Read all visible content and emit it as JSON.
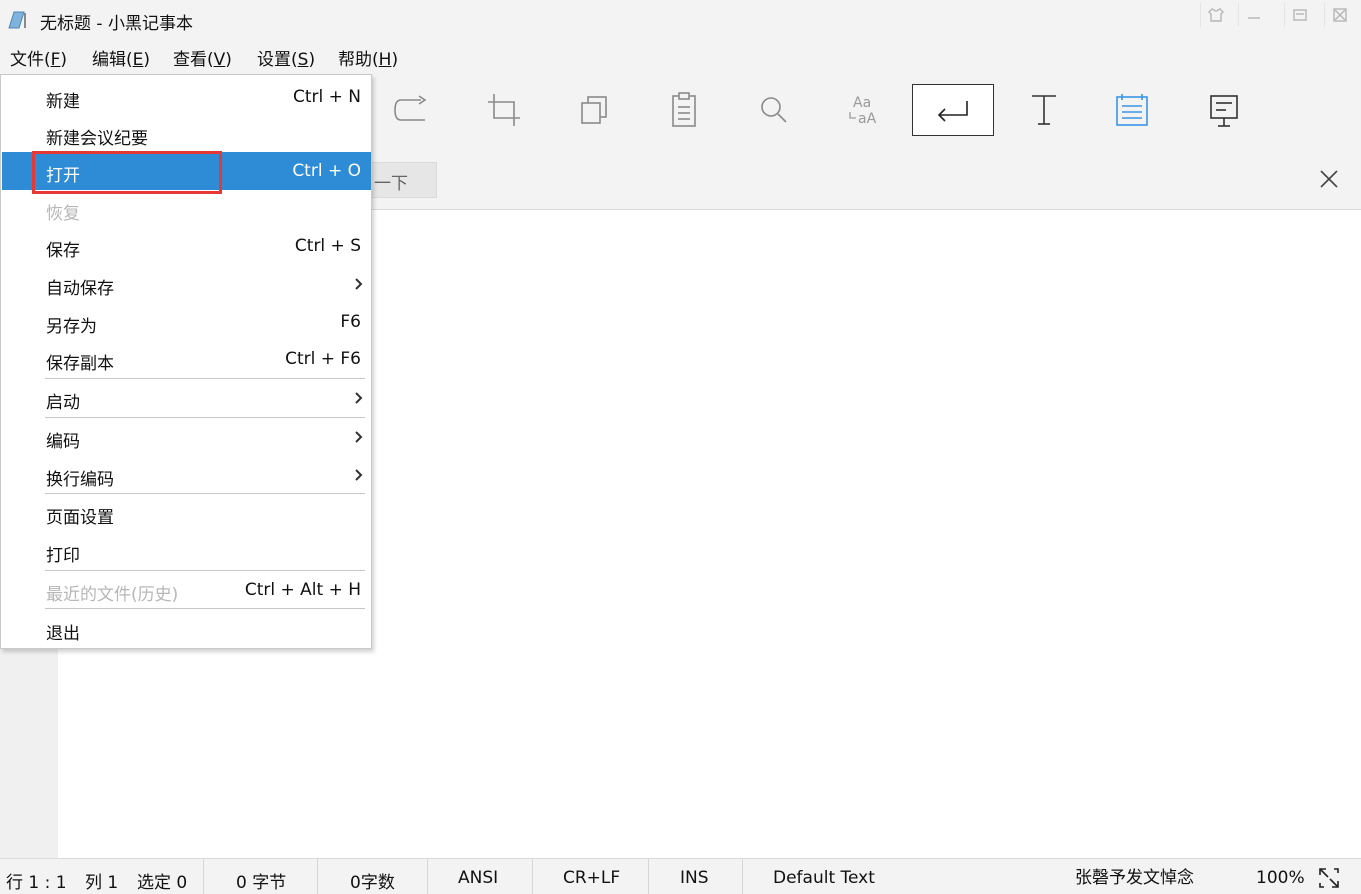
{
  "window": {
    "title": "无标题 - 小黑记事本",
    "controls": [
      "skin-icon",
      "minimize-icon",
      "maximize-icon",
      "close-icon"
    ]
  },
  "menubar": {
    "items": [
      {
        "label": "文件(",
        "key": "F",
        "suffix": ")"
      },
      {
        "label": "编辑(",
        "key": "E",
        "suffix": ")"
      },
      {
        "label": "查看(",
        "key": "V",
        "suffix": ")"
      },
      {
        "label": "设置(",
        "key": "S",
        "suffix": ")"
      },
      {
        "label": "帮助(",
        "key": "H",
        "suffix": ")"
      }
    ]
  },
  "toolbar": {
    "icons": [
      "redo-icon",
      "crop-icon",
      "copy-icon",
      "clipboard-icon",
      "search-icon",
      "case-convert-icon",
      "word-wrap-icon",
      "text-icon",
      "notepad-icon",
      "presentation-icon"
    ],
    "selected": "word-wrap-icon",
    "highlight_color": "#3a96e8"
  },
  "findbar": {
    "next_label": "一下"
  },
  "file_menu": {
    "items": [
      {
        "label": "新建",
        "shortcut": "Ctrl + N"
      },
      {
        "label": "新建会议纪要",
        "shortcut": ""
      },
      {
        "label": "打开",
        "shortcut": "Ctrl + O"
      },
      {
        "label": "恢复",
        "shortcut": ""
      },
      {
        "label": "保存",
        "shortcut": "Ctrl + S"
      },
      {
        "label": "自动保存",
        "shortcut": ""
      },
      {
        "label": "另存为",
        "shortcut": "F6"
      },
      {
        "label": "保存副本",
        "shortcut": "Ctrl + F6"
      },
      {
        "label": "启动",
        "shortcut": ""
      },
      {
        "label": "编码",
        "shortcut": ""
      },
      {
        "label": "换行编码",
        "shortcut": ""
      },
      {
        "label": "页面设置",
        "shortcut": ""
      },
      {
        "label": "打印",
        "shortcut": ""
      },
      {
        "label": "最近的文件(历史)",
        "shortcut": "Ctrl + Alt + H"
      },
      {
        "label": "退出",
        "shortcut": ""
      }
    ],
    "highlighted": "打开",
    "highlight_color": "#2e8bd6",
    "annotation_color": "#e53935"
  },
  "statusbar": {
    "position": "行 1 : 1",
    "column": "列 1",
    "selection": "选定 0",
    "bytes": "0 字节",
    "chars": "0字数",
    "encoding": "ANSI",
    "line_ending": "CR+LF",
    "mode": "INS",
    "syntax": "Default Text",
    "ad_text": "张磬予发文悼念",
    "zoom": "100%"
  }
}
